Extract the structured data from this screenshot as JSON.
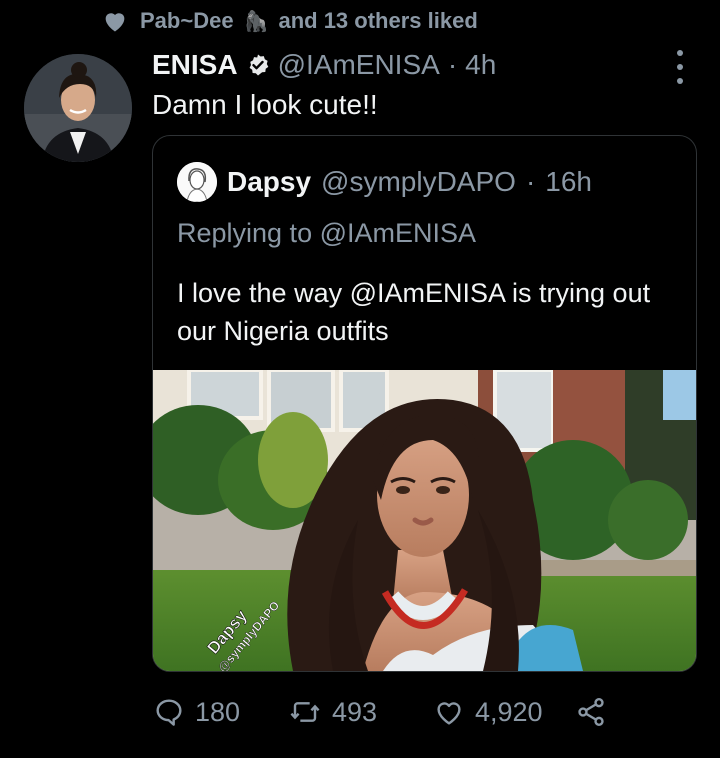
{
  "social_context": {
    "text": "Pab~Dee",
    "emoji": "🦍",
    "suffix": "and 13 others liked"
  },
  "tweet": {
    "author_name": "ENISA",
    "handle": "@IAmENISA",
    "separator": "·",
    "time": "4h",
    "text": "Damn I look cute!!"
  },
  "quote": {
    "author_name": "Dapsy",
    "handle": "@symplyDAPO",
    "separator": "·",
    "time": "16h",
    "replying": "Replying to @IAmENISA",
    "text": "I love the way @IAmENISA is trying out our Nigeria outfits",
    "watermark_name": "Dapsy",
    "watermark_handle": "@symplyDAPO"
  },
  "actions": {
    "replies": "180",
    "retweets": "493",
    "likes": "4,920"
  },
  "colors": {
    "background": "#000000",
    "muted": "#8b98a5",
    "text": "#e7e9ea",
    "border": "#2f3336"
  },
  "icons": [
    "heart-icon",
    "verified-badge-icon",
    "more-icon",
    "reply-icon",
    "retweet-icon",
    "like-icon",
    "share-icon"
  ]
}
